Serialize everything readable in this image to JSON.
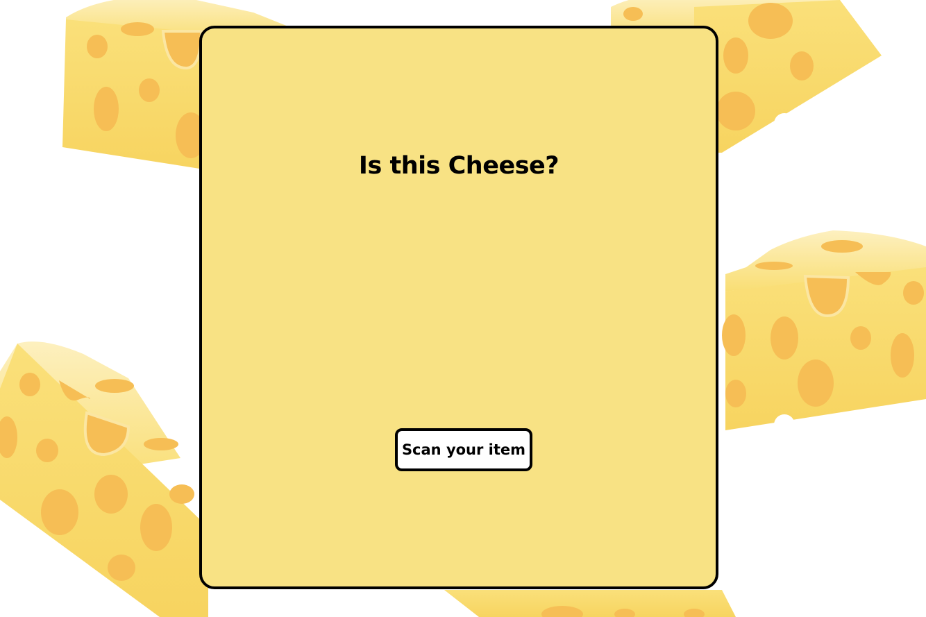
{
  "page": {
    "title": "Is this Cheese?",
    "scan_button_label": "Scan your item"
  },
  "colors": {
    "card_background": "#f8e284",
    "cheese_light": "#f9dc6a",
    "cheese_top": "#fbe8a0",
    "cheese_holes": "#f6be55",
    "border": "#000000"
  },
  "decor": {
    "background_icon": "cheese-wedge-icon"
  }
}
